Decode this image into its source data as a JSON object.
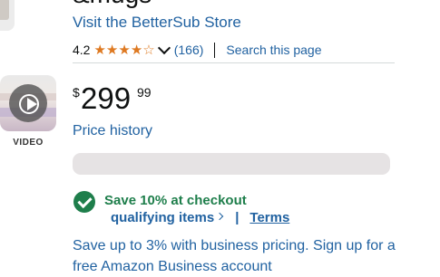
{
  "product": {
    "title_fragment": "&mugs",
    "store_link": "Visit the BetterSub Store"
  },
  "rating": {
    "value": "4.2",
    "stars_filled": 4,
    "stars_total": 5,
    "count": "(166)",
    "search_link": "Search this page"
  },
  "media": {
    "video_label": "VIDEO",
    "icons": [
      "play-icon"
    ]
  },
  "price": {
    "symbol": "$",
    "whole": "299",
    "fraction": "99"
  },
  "price_history_link": "Price history",
  "coupon": {
    "save_text": "Save 10% at checkout",
    "qualifying_link": "qualifying items",
    "separator": "|",
    "terms_link": "Terms"
  },
  "business_text": "Save up to 3% with business pricing. Sign up for a free Amazon Business account",
  "colors": {
    "link": "#2162a1",
    "star": "#de7921",
    "success": "#1e7e4b",
    "text": "#0f1111"
  }
}
